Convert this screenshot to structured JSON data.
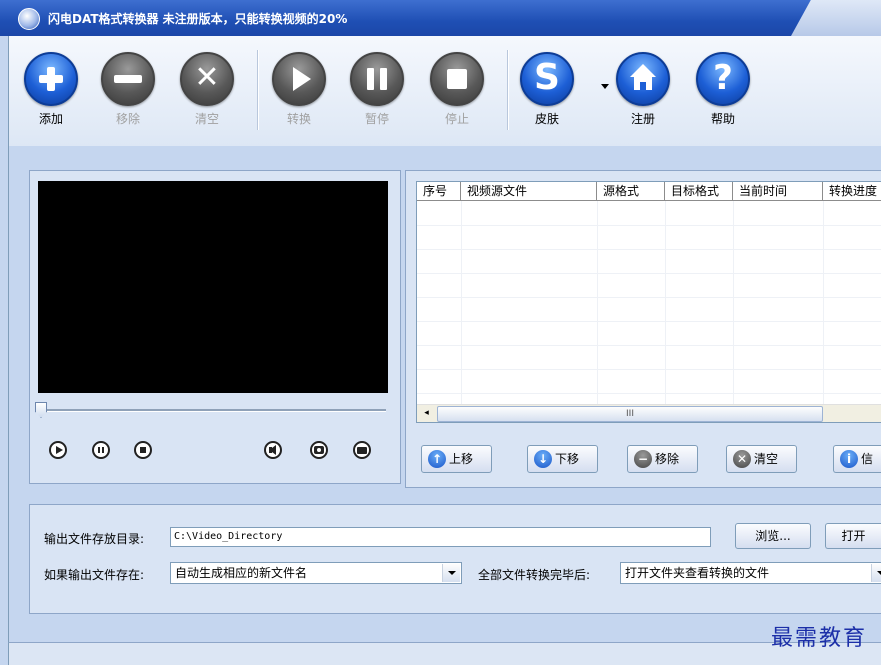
{
  "window": {
    "title": "闪电DAT格式转换器  未注册版本，只能转换视频的20%"
  },
  "toolbar": {
    "add": "添加",
    "remove": "移除",
    "clear": "清空",
    "convert": "转换",
    "pause": "暂停",
    "stop": "停止",
    "skin": "皮肤",
    "register": "注册",
    "help": "帮助"
  },
  "list": {
    "columns": [
      "序号",
      "视频源文件",
      "源格式",
      "目标格式",
      "当前时间",
      "转换进度"
    ],
    "scroll_grip": "III"
  },
  "list_buttons": {
    "up": "上移",
    "down": "下移",
    "remove": "移除",
    "clear": "清空",
    "info": "信"
  },
  "output": {
    "dir_label": "输出文件存放目录:",
    "dir_value": "C:\\Video_Directory",
    "browse": "浏览...",
    "open": "打开",
    "exists_label": "如果输出文件存在:",
    "exists_value": "自动生成相应的新文件名",
    "after_label": "全部文件转换完毕后:",
    "after_value": "打开文件夹查看转换的文件"
  },
  "watermark": "最需教育",
  "colors": {
    "title_bar": "#1f4fb4",
    "accent_blue": "#1d5fd6",
    "disabled_gray": "#585858"
  }
}
